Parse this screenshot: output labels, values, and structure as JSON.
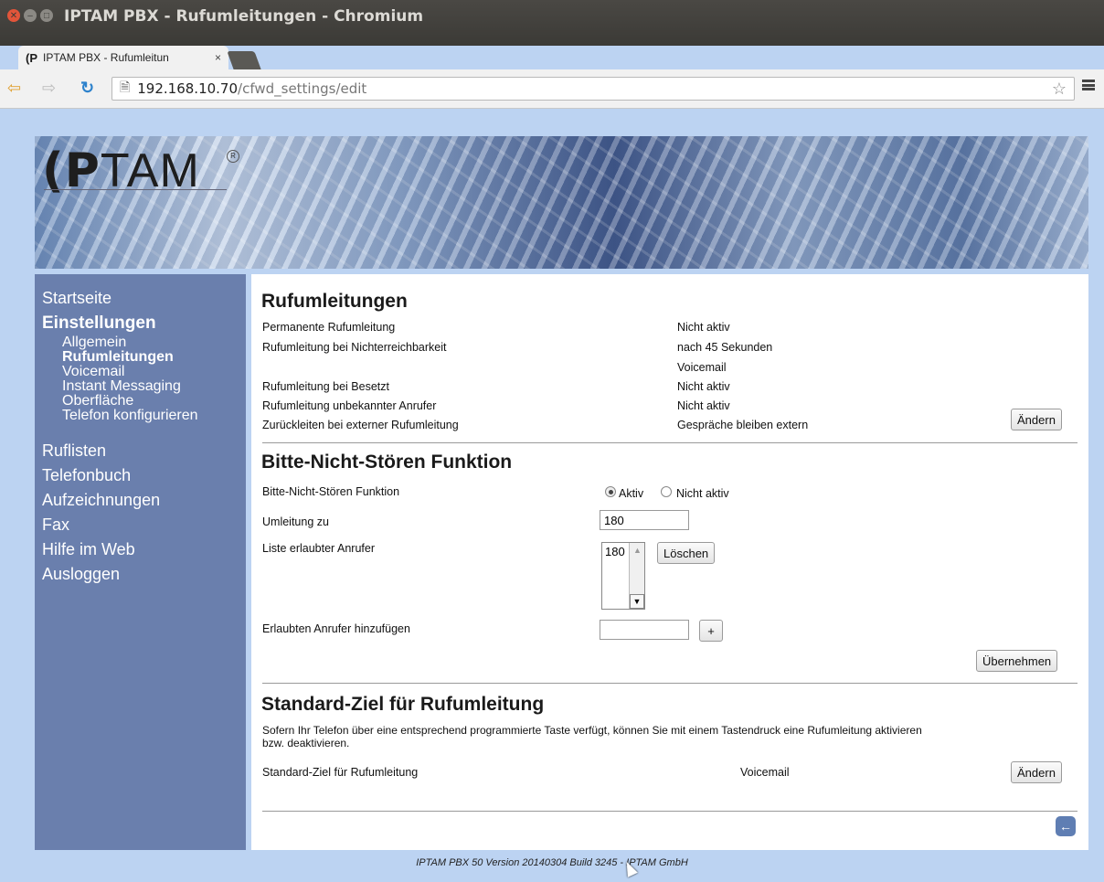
{
  "window": {
    "title": "IPTAM PBX - Rufumleitungen - Chromium"
  },
  "browser": {
    "tab_title": "IPTAM PBX - Rufumleitun",
    "tab_close": "×",
    "favicon": "(P",
    "url_host": "192.168.10.70",
    "url_path": "/cfwd_settings/edit",
    "icons": [
      "back-icon",
      "forward-icon",
      "reload-icon",
      "page-icon",
      "star-icon",
      "menu-icon"
    ]
  },
  "colors": {
    "sidebar_bg": "#6a7fad",
    "page_bg": "#bcd3f2",
    "back_button": "#5f7eb3"
  },
  "banner": {
    "logo_bold": "(P",
    "logo_light": "TAM",
    "logo_mark": "R"
  },
  "sidebar": {
    "items": [
      {
        "label": "Startseite"
      },
      {
        "label": "Einstellungen"
      },
      {
        "label": "Ruflisten"
      },
      {
        "label": "Telefonbuch"
      },
      {
        "label": "Aufzeichnungen"
      },
      {
        "label": "Fax"
      },
      {
        "label": "Hilfe im Web"
      },
      {
        "label": "Ausloggen"
      }
    ],
    "subitems": [
      {
        "label": "Allgemein"
      },
      {
        "label": "Rufumleitungen"
      },
      {
        "label": "Voicemail"
      },
      {
        "label": "Instant Messaging"
      },
      {
        "label": "Oberfläche"
      },
      {
        "label": "Telefon konfigurieren"
      }
    ]
  },
  "forwarding": {
    "title": "Rufumleitungen",
    "rows": [
      {
        "label": "Permanente Rufumleitung",
        "value": "Nicht aktiv"
      },
      {
        "label": "Rufumleitung bei Nichterreichbarkeit",
        "value": "nach 45 Sekunden",
        "value2": "Voicemail"
      },
      {
        "label": "Rufumleitung bei Besetzt",
        "value": "Nicht aktiv"
      },
      {
        "label": "Rufumleitung unbekannter Anrufer",
        "value": "Nicht aktiv"
      },
      {
        "label": "Zurückleiten bei externer Rufumleitung",
        "value": "Gespräche bleiben extern"
      }
    ],
    "edit_button": "Ändern"
  },
  "dnd": {
    "title": "Bitte-Nicht-Stören Funktion",
    "function_label": "Bitte-Nicht-Stören Funktion",
    "active_label": "Aktiv",
    "inactive_label": "Nicht aktiv",
    "active_selected": true,
    "redirect_label": "Umleitung zu",
    "redirect_value": "180",
    "allowed_label": "Liste erlaubter Anrufer",
    "allowed_list": [
      "180"
    ],
    "delete_button": "Löschen",
    "add_label": "Erlaubten Anrufer hinzufügen",
    "add_value": "",
    "add_button": "+",
    "apply_button": "Übernehmen"
  },
  "default_target": {
    "title": "Standard-Ziel für Rufumleitung",
    "description_line1": "Sofern Ihr Telefon über eine entsprechend programmierte Taste verfügt, können Sie mit einem Tastendruck eine Rufumleitung aktivieren",
    "description_line2": "bzw. deaktivieren.",
    "label": "Standard-Ziel für Rufumleitung",
    "value": "Voicemail",
    "edit_button": "Ändern"
  },
  "back_button": "←",
  "footer": "IPTAM PBX 50 Version 20140304 Build 3245 - IPTAM GmbH"
}
